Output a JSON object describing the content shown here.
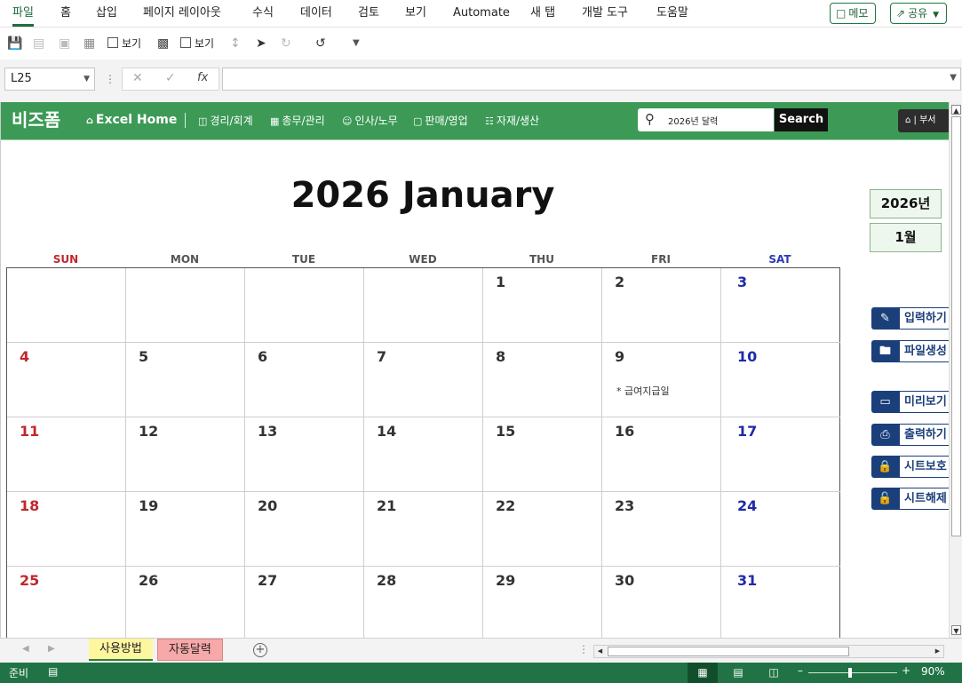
{
  "ribbon": {
    "tabs": [
      "파일",
      "홈",
      "삽입",
      "페이지 레이아웃",
      "수식",
      "데이터",
      "검토",
      "보기",
      "Automate",
      "새 탭",
      "개발 도구",
      "도움말"
    ],
    "active_tab": "파일",
    "memo_label": "메모",
    "share_label": "공유"
  },
  "toolbar": {
    "checkbox1_label": "보기",
    "checkbox2_label": "보기"
  },
  "formula_bar": {
    "name_box": "L25",
    "fx_label": "fx",
    "formula_value": ""
  },
  "web_header": {
    "brand": "비즈폼",
    "nav": [
      "Excel Home",
      "경리/회계",
      "총무/관리",
      "인사/노무",
      "판매/영업",
      "자재/생산"
    ],
    "search_value": "2026년 달력",
    "search_button": "Search",
    "home_label": "부서"
  },
  "calendar": {
    "title": "2026 January",
    "day_headers": [
      "SUN",
      "MON",
      "TUE",
      "WED",
      "THU",
      "FRI",
      "SAT"
    ],
    "weeks": [
      [
        "",
        "",
        "",
        "",
        "1",
        "2",
        "3"
      ],
      [
        "4",
        "5",
        "6",
        "7",
        "8",
        "9",
        "10"
      ],
      [
        "11",
        "12",
        "13",
        "14",
        "15",
        "16",
        "17"
      ],
      [
        "18",
        "19",
        "20",
        "21",
        "22",
        "23",
        "24"
      ],
      [
        "25",
        "26",
        "27",
        "28",
        "29",
        "30",
        "31"
      ]
    ],
    "memo": "* 급여지급일",
    "year_selector": "2026년",
    "month_selector": "1월"
  },
  "side_buttons": [
    "입력하기",
    "파일생성",
    "미리보기",
    "출력하기",
    "시트보호",
    "시트해제"
  ],
  "sheet_tabs": [
    "사용방법",
    "자동달력"
  ],
  "status": {
    "ready": "준비",
    "zoom": "90%"
  },
  "colors": {
    "excel_green": "#217346",
    "header_green": "#3c9a56",
    "sunday_red": "#c0282d",
    "saturday_blue": "#1f2aa8",
    "side_button_navy": "#1b3f7a"
  }
}
